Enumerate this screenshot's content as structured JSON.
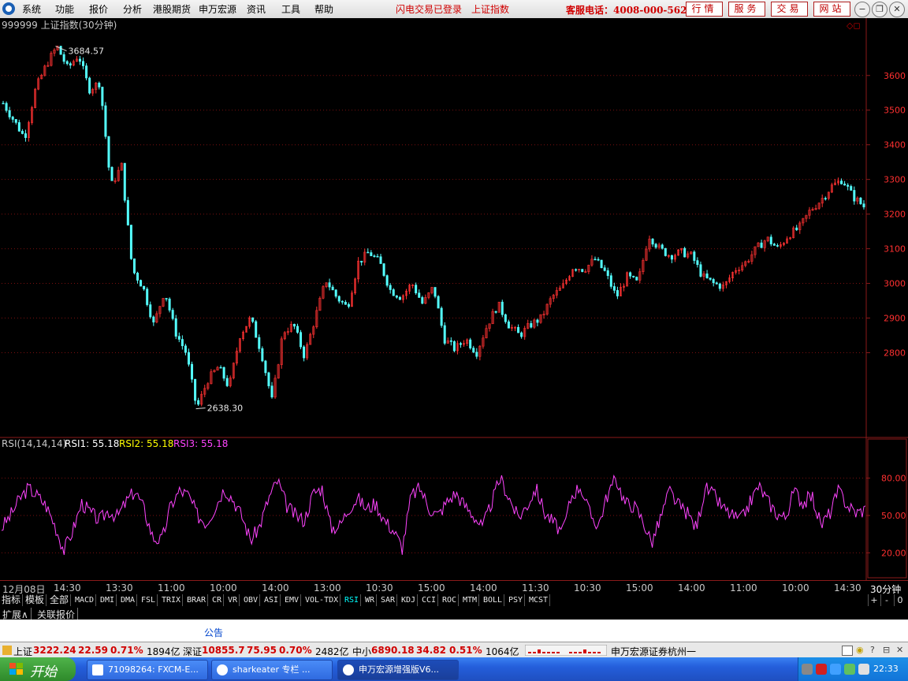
{
  "menu": {
    "items": [
      "系统",
      "功能",
      "报价",
      "分析",
      "港股期货",
      "申万宏源",
      "资讯",
      "工具",
      "帮助"
    ],
    "notice1": "闪电交易已登录",
    "notice2": "上证指数",
    "hotline": "客服电话：4008-000-562",
    "right_buttons": [
      "行情",
      "服务",
      "交易",
      "网站"
    ]
  },
  "chart_data": [
    {
      "type": "candlestick",
      "title": "999999 上证指数(30分钟)",
      "high_label": "3684.57",
      "low_label": "2638.30",
      "ylim": [
        2560,
        3720
      ],
      "yticks": [
        2800,
        2900,
        3000,
        3100,
        3200,
        3300,
        3400,
        3500,
        3600
      ],
      "close_path": [
        3520,
        3470,
        3420,
        3560,
        3630,
        3684.57,
        3620,
        3660,
        3560,
        3580,
        3280,
        3340,
        3040,
        2990,
        2880,
        2980,
        2860,
        2800,
        2638.3,
        2720,
        2760,
        2700,
        2850,
        2900,
        2800,
        2660,
        2860,
        2880,
        2790,
        2900,
        3010,
        2960,
        2930,
        3060,
        3090,
        3060,
        2980,
        2960,
        3000,
        2940,
        2990,
        2840,
        2810,
        2840,
        2800,
        2880,
        2940,
        2880,
        2850,
        2880,
        2900,
        2960,
        2990,
        3050,
        3040,
        3070,
        3030,
        2960,
        3020,
        3000,
        3140,
        3100,
        3080,
        3090,
        3080,
        3020,
        3000,
        2990,
        3040,
        3060,
        3100,
        3130,
        3100,
        3140,
        3160,
        3210,
        3240,
        3280,
        3300,
        3250,
        3222.24
      ]
    },
    {
      "type": "line",
      "title": "RSI(14,14,14)",
      "legend": [
        {
          "label": "RSI1: 55.18",
          "color": "#ffffff"
        },
        {
          "label": "RSI2: 55.18",
          "color": "#ffff00"
        },
        {
          "label": "RSI3: 55.18",
          "color": "#ff44ff"
        }
      ],
      "ylim": [
        0,
        100
      ],
      "yticks": [
        "80.00",
        "50.00",
        "20.00"
      ],
      "series": [
        {
          "values": [
            40,
            50,
            63,
            72,
            66,
            58,
            42,
            22,
            38,
            60,
            52,
            46,
            54,
            49,
            61,
            70,
            55,
            32,
            30,
            58,
            70,
            66,
            50,
            44,
            57,
            72,
            63,
            49,
            30,
            42,
            64,
            78,
            58,
            50,
            46,
            68,
            72,
            40,
            42,
            56,
            64,
            55,
            60,
            46,
            38,
            24,
            66,
            72,
            56,
            50,
            61,
            68,
            58,
            50,
            40,
            60,
            80,
            64,
            48,
            58,
            72,
            52,
            44,
            36,
            66,
            74,
            52,
            42,
            66,
            80,
            60,
            58,
            46,
            28,
            48,
            70,
            58,
            52,
            40,
            72,
            66,
            56,
            50,
            46,
            60,
            74,
            62,
            52,
            48,
            70,
            60,
            66,
            42,
            52,
            70,
            58,
            52,
            55.18
          ]
        }
      ]
    }
  ],
  "time_axis": {
    "labels": [
      "12月08日",
      "14:30",
      "13:30",
      "11:00",
      "10:00",
      "14:00",
      "13:00",
      "10:30",
      "15:00",
      "14:00",
      "11:30",
      "10:30",
      "15:00",
      "14:00",
      "11:00",
      "10:00",
      "14:30"
    ],
    "period": "30分钟"
  },
  "indicator_tabs": [
    "指标",
    "模板",
    "全部",
    "MACD",
    "DMI",
    "DMA",
    "FSL",
    "TRIX",
    "BRAR",
    "CR",
    "VR",
    "OBV",
    "ASI",
    "EMV",
    "VOL-TDX",
    "RSI",
    "WR",
    "SAR",
    "KDJ",
    "CCI",
    "ROC",
    "MTM",
    "BOLL",
    "PSY",
    "MCST"
  ],
  "active_tab": "RSI",
  "tab_controls": [
    "+",
    "-",
    "0"
  ],
  "extend_tabs": [
    "扩展∧",
    "关联报价"
  ],
  "announce_title": "公告",
  "status": {
    "sh_label": "上证",
    "sh_value": "3222.24",
    "sh_change": "22.59",
    "sh_pct": "0.71%",
    "sh_amount": "1894亿",
    "sz_label": "深证",
    "sz_value": "10855.7",
    "sz_change": "75.95",
    "sz_pct": "0.70%",
    "sz_amount": "2482亿",
    "zx_label": "中小",
    "zx_value": "6890.18",
    "zx_change": "34.82",
    "zx_pct": "0.51%",
    "zx_amount": "1064亿",
    "broker": "申万宏源证券杭州一"
  },
  "taskbar": {
    "start": "开始",
    "tasks": [
      "71098264: FXCM-E...",
      "sharkeater 专栏 ...",
      "申万宏源增强版V6..."
    ],
    "clock": "22:33"
  }
}
